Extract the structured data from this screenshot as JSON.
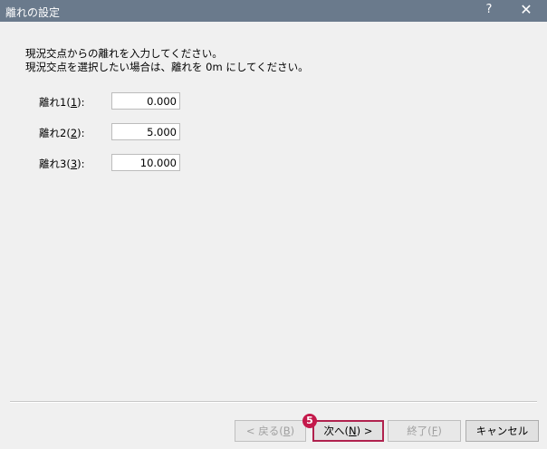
{
  "window": {
    "title": "離れの設定",
    "help_glyph": "?",
    "close_glyph": "✕"
  },
  "description": {
    "line1": "現況交点からの離れを入力してください。",
    "line2": "現況交点を選択したい場合は、離れを 0m にしてください。"
  },
  "fields": [
    {
      "label_pre": "離れ1(",
      "mnemonic": "1",
      "label_post": "):",
      "value": "0.000"
    },
    {
      "label_pre": "離れ2(",
      "mnemonic": "2",
      "label_post": "):",
      "value": "5.000"
    },
    {
      "label_pre": "離れ3(",
      "mnemonic": "3",
      "label_post": "):",
      "value": "10.000"
    }
  ],
  "buttons": {
    "back": {
      "pre": "< 戻る(",
      "mnemonic": "B",
      "post": ")"
    },
    "next": {
      "pre": "次へ(",
      "mnemonic": "N",
      "post": ") >"
    },
    "finish": {
      "pre": "終了(",
      "mnemonic": "F",
      "post": ")"
    },
    "cancel": {
      "label": "キャンセル"
    }
  },
  "step_badge": "5",
  "colors": {
    "titlebar": "#6a7a8c",
    "highlight": "#b0224e",
    "badge": "#c4194b"
  }
}
